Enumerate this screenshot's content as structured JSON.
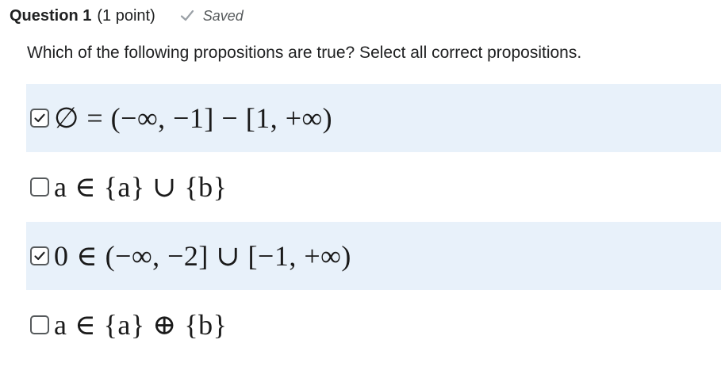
{
  "question": {
    "title": "Question 1",
    "points": "(1 point)",
    "status": "Saved",
    "status_icon": "checkmark-icon",
    "prompt": "Which of the following propositions are true? Select all correct propositions."
  },
  "options": [
    {
      "text": "∅ = (−∞, −1] − [1, +∞)",
      "checked": true
    },
    {
      "text": "a ∈ {a} ∪ {b}",
      "checked": false
    },
    {
      "text": "0 ∈ (−∞, −2] ∪ [−1, +∞)",
      "checked": true
    },
    {
      "text": "a ∈ {a} ⊕ {b}",
      "checked": false
    }
  ],
  "colors": {
    "selected_row_bg": "#e8f1fa",
    "saved_check": "#9aa0a6",
    "checkbox_border": "#565a5c"
  }
}
